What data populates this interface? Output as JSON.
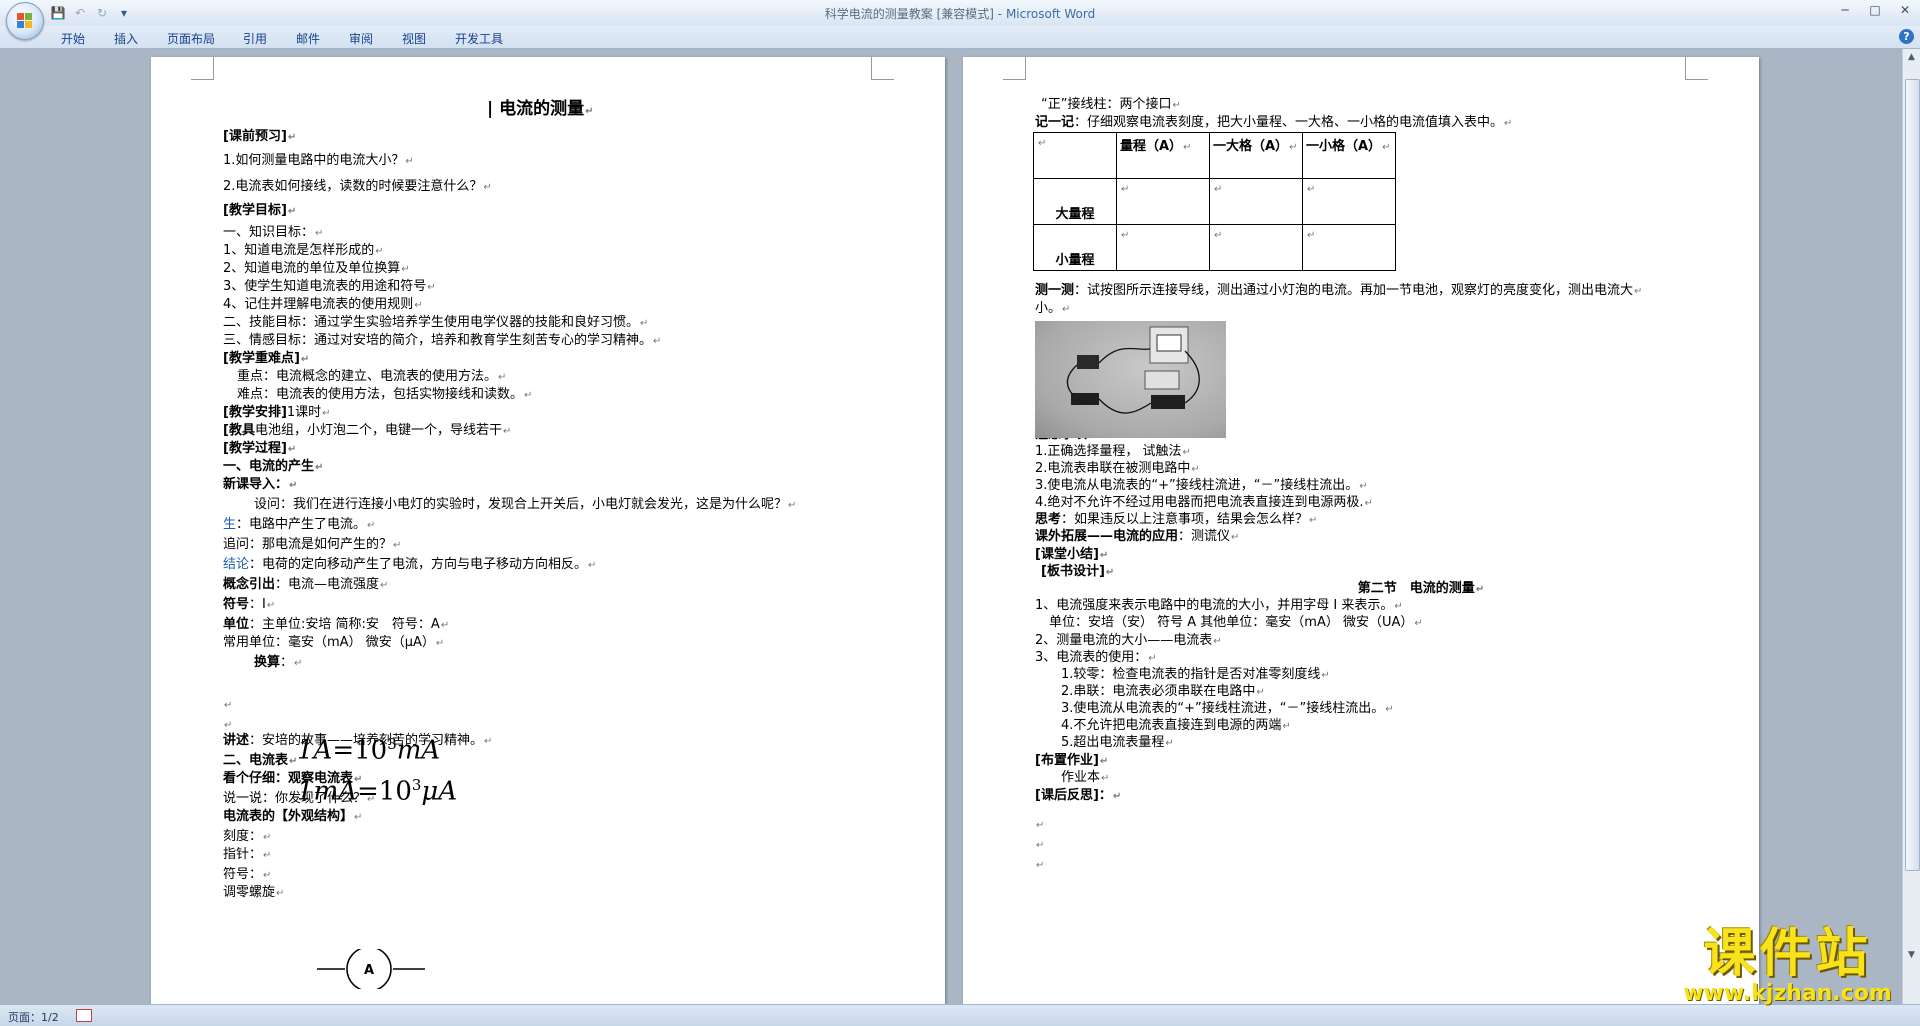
{
  "window": {
    "title": "科学电流的测量教案 [兼容模式]",
    "title_sep": " - ",
    "app_name": "Microsoft Word",
    "minimize_glyph": "─",
    "maximize_glyph": "□",
    "close_glyph": "✕"
  },
  "quick_access": {
    "save_icon": "💾",
    "undo_icon": "↶",
    "redo_icon": "↻",
    "menu_icon": "▾"
  },
  "ribbon": {
    "tabs": [
      "开始",
      "插入",
      "页面布局",
      "引用",
      "邮件",
      "审阅",
      "视图",
      "开发工具"
    ],
    "help_glyph": "?"
  },
  "colors": {
    "office_logo": [
      "#e8532b",
      "#7bb33a",
      "#2f84d6",
      "#f4b720"
    ]
  },
  "page1": {
    "lines": [
      {
        "text": "电流的测量",
        "style": "title"
      },
      {
        "text": "[课前预习]",
        "style": "bold"
      },
      {
        "text": "1.如何测量电路中的电流大小？"
      },
      {
        "text": "2.电流表如何接线，读数的时候要注意什么？"
      },
      {
        "text": "[教学目标]",
        "style": "bold"
      },
      {
        "text": "一、知识目标："
      },
      {
        "text": "1、知道电流是怎样形成的"
      },
      {
        "text": "2、知道电流的单位及单位换算"
      },
      {
        "text": "3、使学生知道电流表的用途和符号"
      },
      {
        "text": "4、记住并理解电流表的使用规则"
      },
      {
        "text": "二、技能目标：通过学生实验培养学生使用电学仪器的技能和良好习惯。"
      },
      {
        "text": "三、情感目标：通过对安培的简介，培养和教育学生刻苦专心的学习精神。"
      },
      {
        "text": "[教学重难点]",
        "style": "bold"
      },
      {
        "text": "重点：电流概念的建立、电流表的使用方法。"
      },
      {
        "text": "难点：电流表的使用方法，包括实物接线和读数。"
      },
      {
        "bold": "[教学安排]",
        "text": "1课时"
      },
      {
        "bold": "[教具",
        "text": "电池组，小灯泡二个，电键一个，导线若干"
      },
      {
        "text": "[教学过程]",
        "style": "bold"
      },
      {
        "text": "一、电流的产生",
        "style": "bold"
      },
      {
        "text": "新课导入：",
        "style": "bold"
      },
      {
        "text": "设问：我们在进行连接小电灯的实验时，发现合上开关后，小电灯就会发光，这是为什么呢？"
      },
      {
        "blue": "生",
        "text": "：电路中产生了电流。"
      },
      {
        "text": "追问：那电流是如何产生的？"
      },
      {
        "blue": "结论",
        "text": "：电荷的定向移动产生了电流，方向与电子移动方向相反。"
      },
      {
        "bold": "概念引出",
        "text": "：电流—电流强度"
      },
      {
        "bold": "符号",
        "text": "：I"
      },
      {
        "bold": "单位",
        "text": "：主单位:安培 简称:安　符号：A"
      },
      {
        "text": "常用单位：毫安（mA） 微安（μA）"
      },
      {
        "bold": "换算",
        "text": "："
      },
      {
        "text": ""
      },
      {
        "text": ""
      },
      {
        "bold": "讲述",
        "text": "：安培的故事——培养刻苦的学习精神。"
      },
      {
        "text": "二、电流表",
        "style": "bold"
      },
      {
        "text": "看个仔细：观察电流表",
        "style": "bold"
      },
      {
        "text": "说一说：你发现了什么？"
      },
      {
        "text": "电流表的【外观结构】",
        "boldpart": true
      },
      {
        "text": "刻度："
      },
      {
        "text": "指针："
      },
      {
        "text": "符号："
      },
      {
        "text": "调零螺旋"
      }
    ],
    "formula1": {
      "lhs": "1A",
      "eq": "=",
      "base": "10",
      "exp": "3",
      "unit": "mA"
    },
    "formula2": {
      "lhs": "1mA",
      "eq": "=",
      "base": "10",
      "exp": "3",
      "unit": "μA"
    },
    "ammeter_symbol_label": "A"
  },
  "page2": {
    "lines": [
      {
        "text": "“正”接线柱：两个接口"
      },
      {
        "bold": "记一记",
        "text": "：仔细观察电流表刻度，把大小量程、一大格、一小格的电流值填入表中。"
      }
    ],
    "table": {
      "header": [
        "",
        "量程（A）",
        "一大格（A）",
        "一小格（A）"
      ],
      "rows": [
        [
          "大量程",
          "",
          "",
          ""
        ],
        [
          "小量程",
          "",
          "",
          ""
        ]
      ]
    },
    "lines_after": [
      {
        "bold": "测一测",
        "text": "：试按图所示连接导线，测出通过小灯泡的电流。再加一节电池，观察灯的亮度变化，测出电流大"
      },
      {
        "text": "小。"
      }
    ],
    "lines_notes": [
      {
        "text": "注意事项：",
        "style": "bold"
      },
      {
        "text": "1.正确选择量程， 试触法"
      },
      {
        "text": "2.电流表串联在被测电路中"
      },
      {
        "text": "3.使电流从电流表的“+”接线柱流进，“－”接线柱流出。"
      },
      {
        "text": "4.绝对不允许不经过用电器而把电流表直接连到电源两极."
      },
      {
        "bold": "思考",
        "text": "：如果违反以上注意事项，结果会怎么样？"
      },
      {
        "bold": "课外拓展——电流的应用",
        "text": "：测谎仪"
      },
      {
        "text": "[课堂小结]",
        "style": "bold"
      },
      {
        "text": "[板书设计]",
        "style": "bold"
      },
      {
        "text": "第二节　电流的测量",
        "style": "center-bold"
      },
      {
        "text": "1、电流强度来表示电路中的电流的大小，并用字母 I 来表示。"
      },
      {
        "text": "单位：安培（安） 符号 A 其他单位：毫安（mA） 微安（UA）"
      },
      {
        "text": "2、测量电流的大小——电流表"
      },
      {
        "text": "3、电流表的使用："
      },
      {
        "text": "1.较零：检查电流表的指针是否对准零刻度线"
      },
      {
        "text": "2.串联：电流表必须串联在电路中"
      },
      {
        "text": "3.使电流从电流表的“+”接线柱流进，“－”接线柱流出。"
      },
      {
        "text": "4.不允许把电流表直接连到电源的两端"
      },
      {
        "text": "5.超出电流表量程"
      },
      {
        "text": "[布置作业]",
        "style": "bold"
      },
      {
        "text": "作业本"
      },
      {
        "text": "[课后反思]：",
        "style": "bold"
      }
    ]
  },
  "status": {
    "page": "页面：1/2"
  },
  "watermark": {
    "main": "课件站",
    "url": "www.kjzhan.com"
  }
}
